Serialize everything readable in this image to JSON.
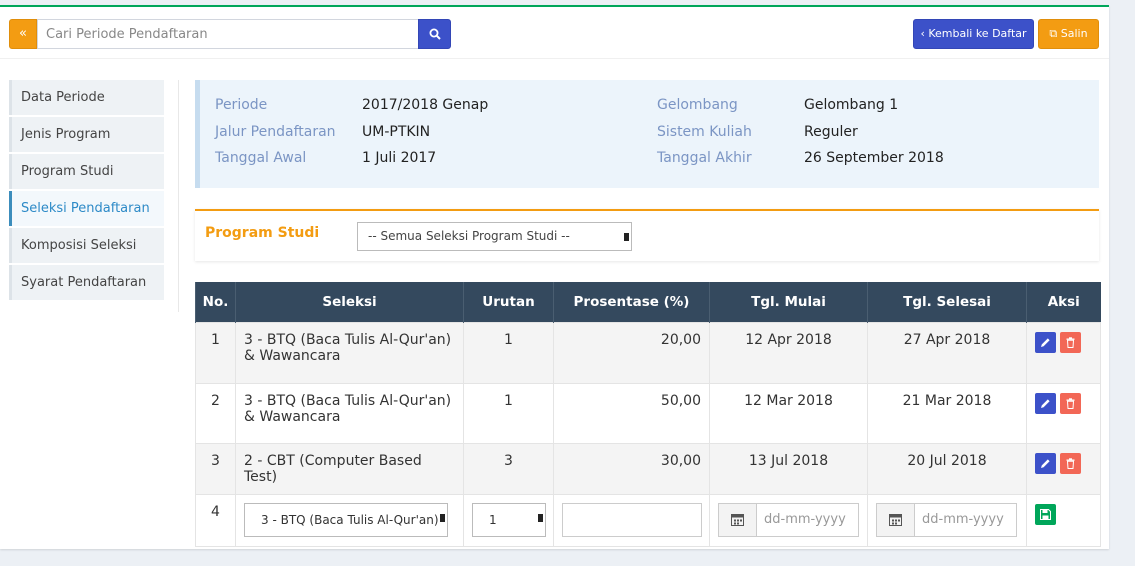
{
  "topbar": {
    "back_label": "«",
    "search_placeholder": "Cari Periode Pendaftaran",
    "kembali_label": "Kembali ke Daftar",
    "salin_label": "Salin"
  },
  "sidebar": {
    "items": [
      {
        "label": "Data Periode"
      },
      {
        "label": "Jenis Program"
      },
      {
        "label": "Program Studi"
      },
      {
        "label": "Seleksi Pendaftaran"
      },
      {
        "label": "Komposisi Seleksi"
      },
      {
        "label": "Syarat Pendaftaran"
      }
    ]
  },
  "info": {
    "periode_label": "Periode",
    "periode_value": "2017/2018 Genap",
    "jalur_label": "Jalur Pendaftaran",
    "jalur_value": "UM-PTKIN",
    "tawal_label": "Tanggal Awal",
    "tawal_value": "1 Juli 2017",
    "gelombang_label": "Gelombang",
    "gelombang_value": "Gelombang 1",
    "sistem_label": "Sistem Kuliah",
    "sistem_value": "Reguler",
    "takhir_label": "Tanggal Akhir",
    "takhir_value": "26 September 2018"
  },
  "filter": {
    "label": "Program Studi",
    "selected": "-- Semua Seleksi Program Studi --"
  },
  "table": {
    "headers": [
      "No.",
      "Seleksi",
      "Urutan",
      "Prosentase (%)",
      "Tgl. Mulai",
      "Tgl. Selesai",
      "Aksi"
    ],
    "rows": [
      {
        "no": "1",
        "seleksi": "3 - BTQ (Baca Tulis Al-Qur'an) & Wawancara",
        "urutan": "1",
        "prosentase": "20,00",
        "mulai": "12 Apr 2018",
        "selesai": "27 Apr 2018"
      },
      {
        "no": "2",
        "seleksi": "3 - BTQ (Baca Tulis Al-Qur'an) & Wawancara",
        "urutan": "1",
        "prosentase": "50,00",
        "mulai": "12 Mar 2018",
        "selesai": "21 Mar 2018"
      },
      {
        "no": "3",
        "seleksi": "2 - CBT (Computer Based Test)",
        "urutan": "3",
        "prosentase": "30,00",
        "mulai": "13 Jul 2018",
        "selesai": "20 Jul 2018"
      }
    ],
    "new_row": {
      "no": "4",
      "seleksi_selected": "3 - BTQ (Baca Tulis Al-Qur'an)",
      "urutan_selected": "1",
      "date_placeholder": "dd-mm-yyyy"
    }
  },
  "colors": {
    "primary": "#3c51c9",
    "warning": "#f39c12",
    "danger": "#f26756",
    "success": "#00a65a",
    "header": "#34495e"
  }
}
